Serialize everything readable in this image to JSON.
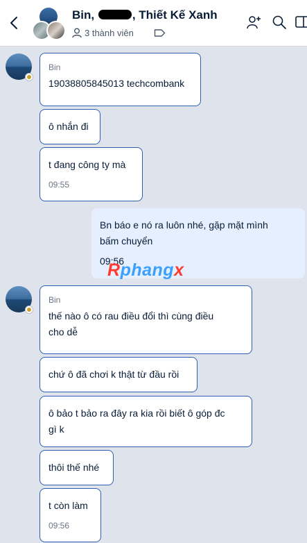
{
  "header": {
    "title_part1": "Bin,",
    "title_part2": ", Thiết Kế Xanh",
    "members": "3 thành viên"
  },
  "messages": [
    {
      "sender": "Bin",
      "text": "19038805845013 techcombank"
    },
    {
      "text": "ô nhắn đi"
    },
    {
      "text": "t đang công ty mà",
      "time": "09:55"
    },
    {
      "line1": "Bn báo e nó ra luôn nhé, gặp mặt mình",
      "line2": "bấm chuyển",
      "time": "09:56"
    },
    {
      "sender": "Bin",
      "line1": "thế nào ô có rau điều đổi thì cùng điều",
      "line2": "cho dễ"
    },
    {
      "text": "chứ ô đã chơi k thật từ đầu rồi"
    },
    {
      "line1": "ô bảo t bảo ra đây ra kia rồi biết ô góp đc",
      "line2": "gì k"
    },
    {
      "text": "thôi thế nhé"
    },
    {
      "text": "t còn làm",
      "time": "09:56"
    }
  ],
  "watermark": {
    "part1": "R",
    "part2": "phang",
    "part3": "x"
  }
}
